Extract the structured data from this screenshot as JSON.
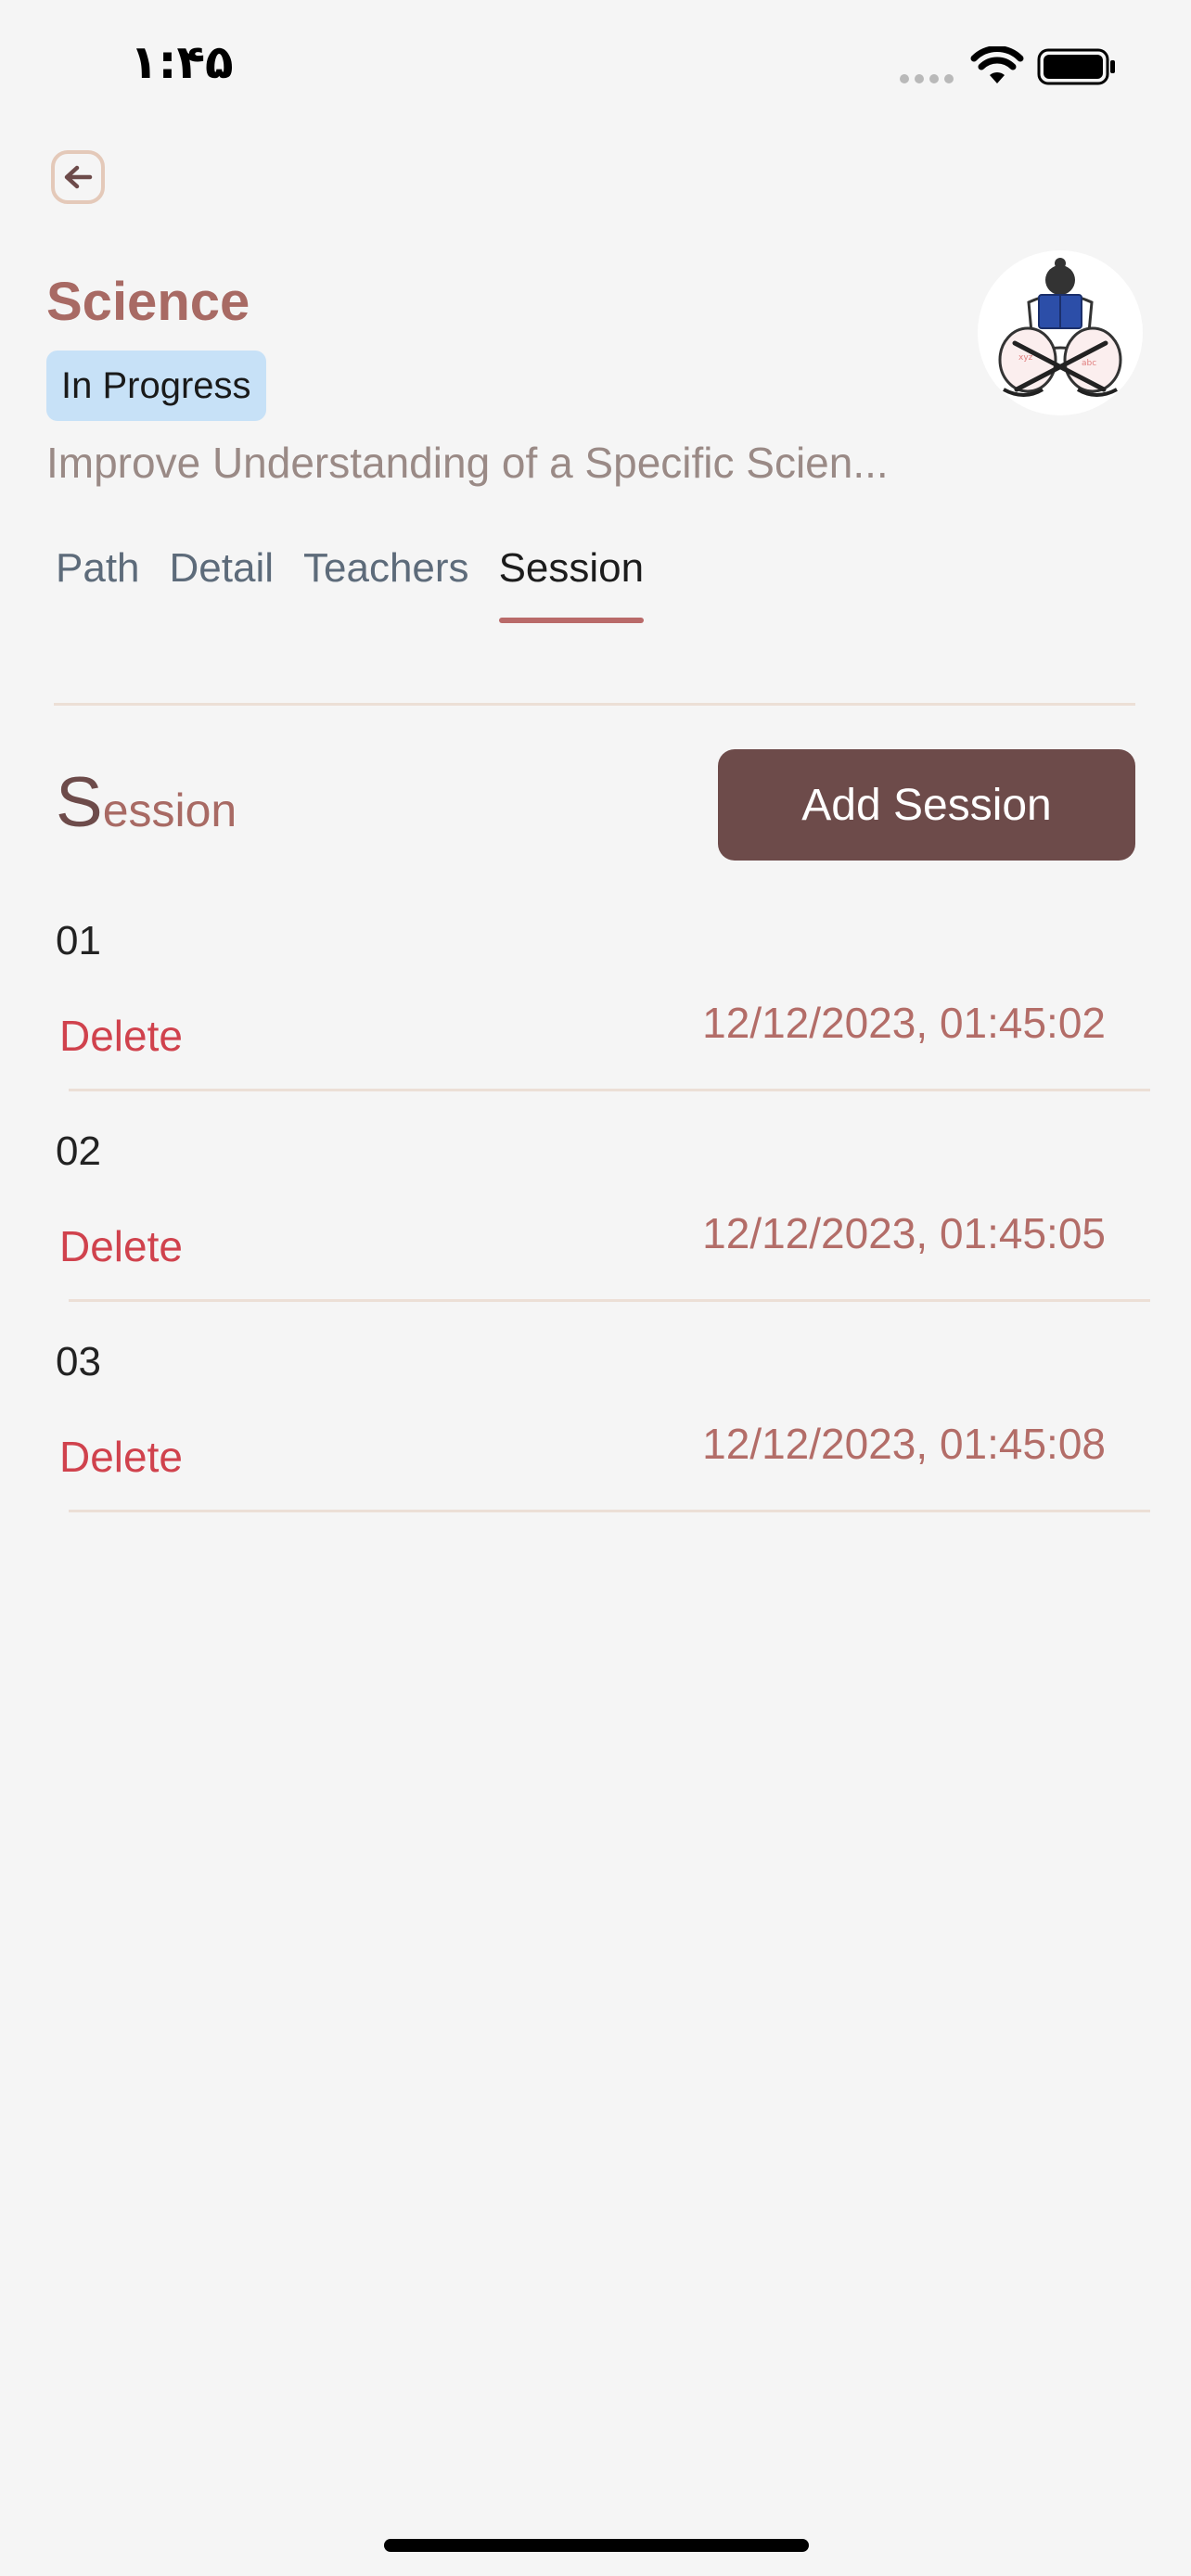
{
  "status_bar": {
    "time": "۱:۴۵",
    "icons": [
      "signal-dots-icon",
      "wifi-icon",
      "battery-icon"
    ]
  },
  "header": {
    "back_icon": "arrow-left-icon",
    "title": "Science",
    "badge": "In Progress",
    "subtitle": "Improve Understanding of a Specific Scien..."
  },
  "tabs": [
    {
      "label": "Path",
      "active": false
    },
    {
      "label": "Detail",
      "active": false
    },
    {
      "label": "Teachers",
      "active": false
    },
    {
      "label": "Session",
      "active": true
    }
  ],
  "section": {
    "title_first": "S",
    "title_rest": "ession",
    "add_button": "Add Session"
  },
  "sessions": [
    {
      "number": "01",
      "delete_label": "Delete",
      "datetime": "12/12/2023, 01:45:02"
    },
    {
      "number": "02",
      "delete_label": "Delete",
      "datetime": "12/12/2023, 01:45:05"
    },
    {
      "number": "03",
      "delete_label": "Delete",
      "datetime": "12/12/2023, 01:45:08"
    }
  ],
  "colors": {
    "accent": "#a86a64",
    "primary_button": "#6d4b4a",
    "delete": "#d0424d",
    "badge_bg": "#c7e1f7",
    "background": "#f5f5f5"
  }
}
